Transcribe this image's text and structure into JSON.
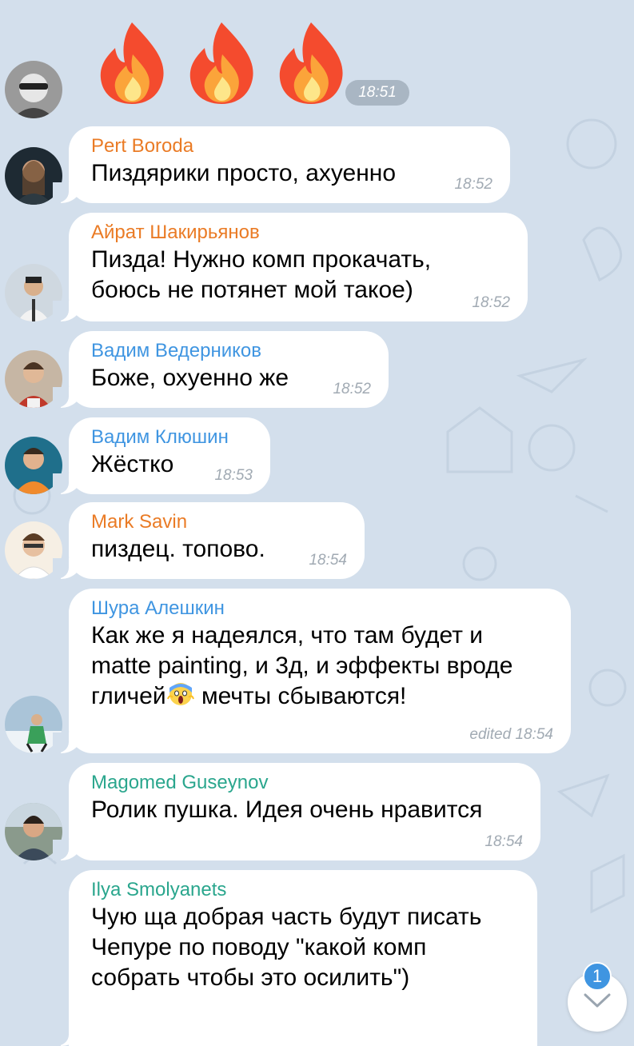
{
  "colors": {
    "background": "#d3dfec",
    "orange_name": "#ea7b25",
    "blue_name": "#3f95e1",
    "teal_name": "#2aa68d",
    "time": "#a1aab3",
    "badge": "#3f95e1"
  },
  "sticker_message": {
    "icons": [
      "fire-icon",
      "fire-icon",
      "fire-icon"
    ],
    "time": "18:51"
  },
  "messages": [
    {
      "sender": "Pert Boroda",
      "lines": [
        "Пиздярики просто, ахуенно"
      ],
      "time": "18:52",
      "name_color": "#ea7b25"
    },
    {
      "sender": "Айрат Шакирьянов",
      "lines": [
        "Пизда! Нужно комп прокачать,",
        "боюсь не потянет мой такое)"
      ],
      "time": "18:52",
      "name_color": "#ea7b25"
    },
    {
      "sender": "Вадим Ведерников",
      "lines": [
        "Боже, охуенно же"
      ],
      "time": "18:52",
      "name_color": "#3f95e1"
    },
    {
      "sender": "Вадим Клюшин",
      "lines": [
        "Жёстко"
      ],
      "time": "18:53",
      "name_color": "#3f95e1"
    },
    {
      "sender": "Mark Savin",
      "lines": [
        "пиздец. топово."
      ],
      "time": "18:54",
      "name_color": "#ea7b25"
    },
    {
      "sender": "Шура Алешкин",
      "lines": [
        "Как же я надеялся, что там будет и",
        "matte painting, и 3д, и эффекты вроде",
        "гличей",
        " мечты сбываются!"
      ],
      "time": "edited 18:54",
      "name_color": "#3f95e1"
    },
    {
      "sender": "Magomed Guseynov",
      "lines": [
        "Ролик пушка. Идея очень нравится"
      ],
      "time": "18:54",
      "name_color": "#2aa68d"
    },
    {
      "sender": "Ilya Smolyanets",
      "lines": [
        "Чую ща добрая часть будут писать",
        "Чепуре по поводу \"какой комп",
        "собрать чтобы это осилить\")"
      ],
      "time": "",
      "name_color": "#2aa68d"
    }
  ],
  "scroll_down": {
    "badge_count": "1",
    "icon": "chevron-down-icon"
  }
}
